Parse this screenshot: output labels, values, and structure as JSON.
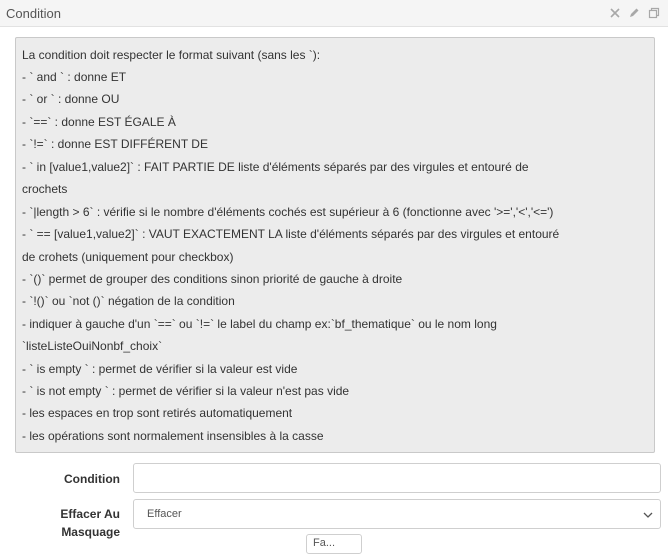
{
  "panel": {
    "title": "Condition",
    "icons": [
      "close-icon",
      "pencil-icon",
      "copy-icon"
    ]
  },
  "help": {
    "lines": [
      "La condition doit respecter le format suivant (sans les `):",
      "- ` and ` : donne ET",
      "- ` or ` : donne OU",
      "- `==` : donne EST ÉGALE À",
      "- `!=` : donne EST DIFFÉRENT DE",
      "- ` in [value1,value2]` : FAIT PARTIE DE liste d'éléments séparés par des virgules et entouré de",
      "crochets",
      "- `|length > 6` : vérifie si le nombre d'éléments cochés est supérieur à 6 (fonctionne avec '>=','<','<=')",
      "- ` == [value1,value2]` : VAUT EXACTEMENT LA liste d'éléments séparés par des virgules et entouré",
      "de crohets (uniquement pour checkbox)",
      "- `()` permet de grouper des conditions sinon priorité de gauche à droite",
      "- `!()` ou `not ()` négation de la condition",
      "- indiquer à gauche d'un `==` ou `!=` le label du champ ex:`bf_thematique` ou le nom long",
      "`listeListeOuiNonbf_choix`",
      "- ` is empty ` : permet de vérifier si la valeur est vide",
      "- ` is not empty ` : permet de vérifier si la valeur n'est pas vide",
      "- les espaces en trop sont retirés automatiquement",
      "- les opérations sont normalement insensibles à la casse"
    ]
  },
  "form": {
    "condition_label": "Condition",
    "condition_value": "",
    "effacer_label_line1": "Effacer Au",
    "effacer_label_line2": "Masquage",
    "effacer_value": "Effacer",
    "partial_value": "Fa..."
  }
}
